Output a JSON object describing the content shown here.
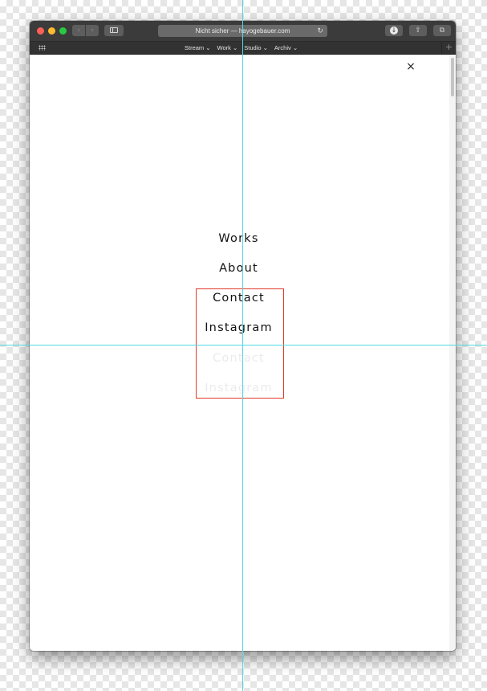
{
  "browser": {
    "address_text": "Nicht sicher — hayogebauer.com",
    "nav_back_glyph": "‹",
    "nav_forward_glyph": "›",
    "reload_glyph": "↻",
    "download_glyph": "↓",
    "share_glyph": "⇪",
    "tabs_glyph": "⧉",
    "add_glyph": "+",
    "favorites": [
      {
        "label": "Stream ⌄"
      },
      {
        "label": "Work ⌄"
      },
      {
        "label": "Studio ⌄"
      },
      {
        "label": "Archiv ⌄"
      }
    ],
    "colors": {
      "close": "#fe5f57",
      "minimize": "#febb2e",
      "zoom": "#28c840"
    }
  },
  "page": {
    "close_glyph": "×",
    "menu": [
      {
        "label": "Works"
      },
      {
        "label": "About"
      },
      {
        "label": "Contact"
      },
      {
        "label": "Instagram"
      }
    ],
    "ghost_menu": [
      {
        "label": "Contact"
      },
      {
        "label": "Instagram"
      }
    ]
  },
  "overlay": {
    "guide_color": "#4fd9e3",
    "highlight_color": "#e23a2a"
  }
}
